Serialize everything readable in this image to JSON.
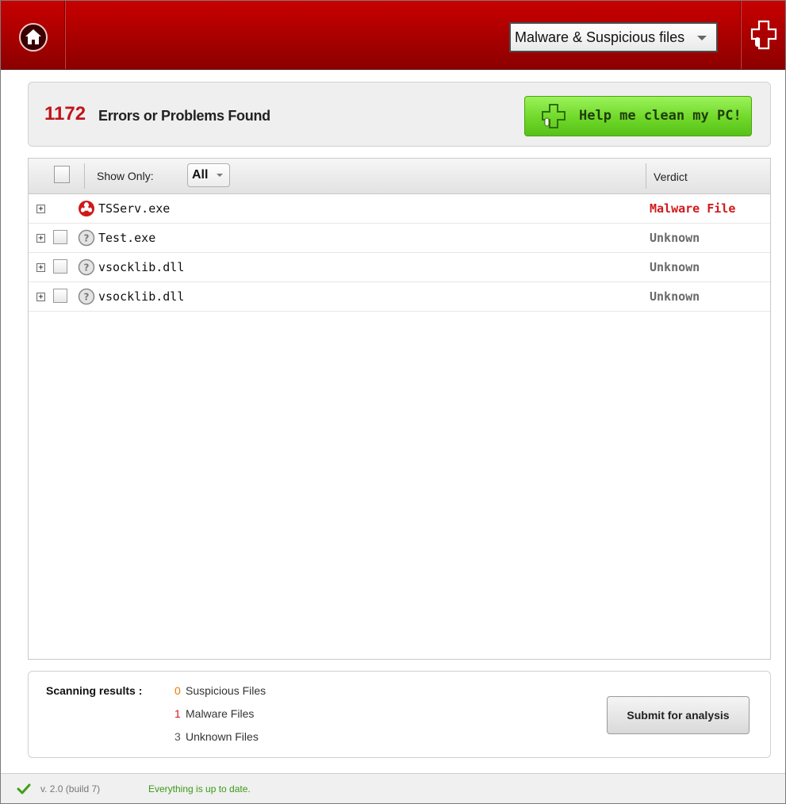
{
  "header": {
    "filter_value": "Malware & Suspicious files"
  },
  "summary": {
    "error_count": "1172",
    "error_text": "Errors or Problems Found",
    "clean_button": "Help me clean my PC!"
  },
  "table": {
    "show_only_label": "Show Only:",
    "filter_value": "All",
    "verdict_header": "Verdict",
    "rows": [
      {
        "name": "TSServ.exe",
        "verdict": "Malware File",
        "status": "malware",
        "verdict_color": "#d11a1a",
        "has_checkbox": false
      },
      {
        "name": "Test.exe",
        "verdict": "Unknown",
        "status": "unknown",
        "verdict_color": "#6a6a6a",
        "has_checkbox": true
      },
      {
        "name": "vsocklib.dll",
        "verdict": "Unknown",
        "status": "unknown",
        "verdict_color": "#6a6a6a",
        "has_checkbox": true
      },
      {
        "name": "vsocklib.dll",
        "verdict": "Unknown",
        "status": "unknown",
        "verdict_color": "#6a6a6a",
        "has_checkbox": true
      }
    ]
  },
  "scan": {
    "label": "Scanning results :",
    "items": [
      {
        "count": "0",
        "text": "Suspicious Files",
        "color": "#f07800"
      },
      {
        "count": "1",
        "text": "Malware Files",
        "color": "#d11a1a"
      },
      {
        "count": "3",
        "text": "Unknown Files",
        "color": "#555555"
      }
    ],
    "submit_button": "Submit for analysis"
  },
  "statusbar": {
    "version": "v. 2.0 (build 7)",
    "status_text": "Everything is up to date."
  },
  "colors": {
    "header_red": "#a80000",
    "accent_green": "#6fd829",
    "error_red": "#c0141b"
  },
  "icons": {
    "home": "home-icon",
    "brand": "cross-logo-icon",
    "malware": "biohazard-icon",
    "unknown": "question-icon",
    "check": "checkmark-icon"
  }
}
